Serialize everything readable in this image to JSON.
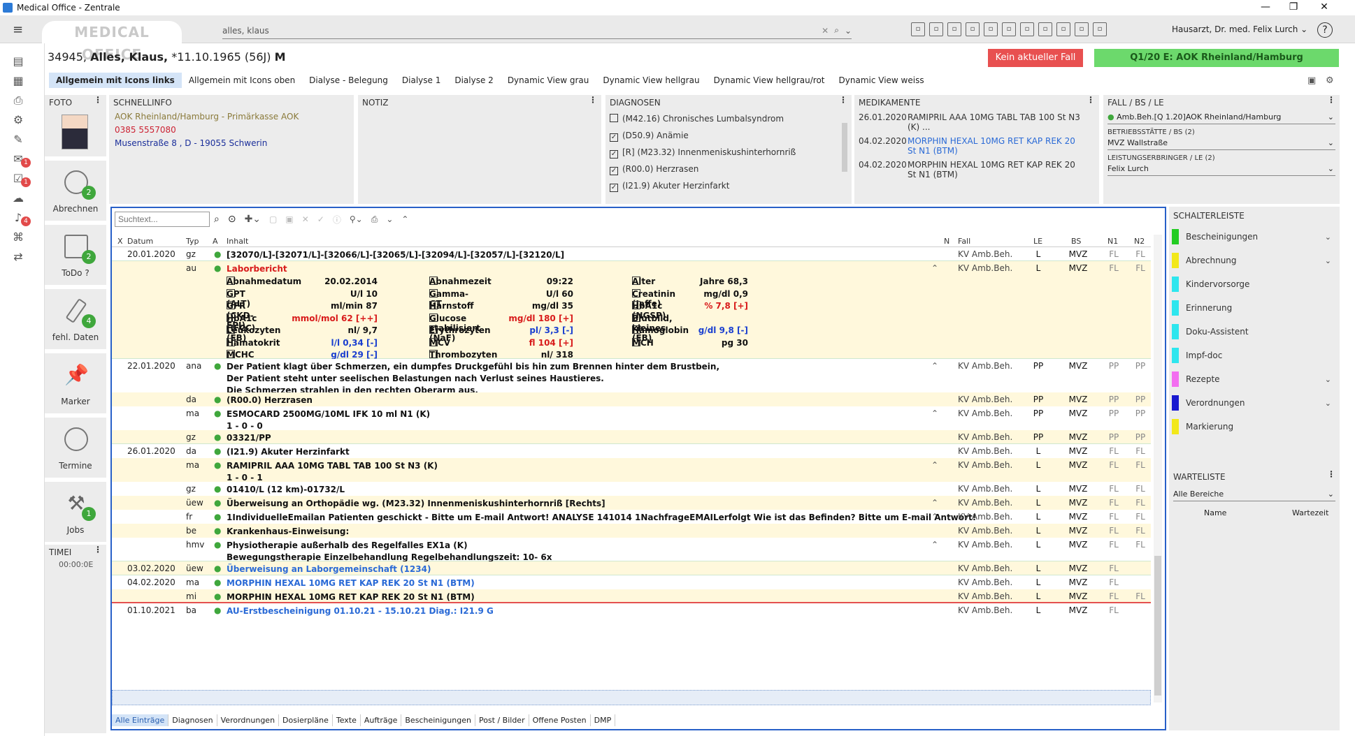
{
  "window": {
    "title": "Medical Office - Zentrale",
    "min": "—",
    "max": "❐",
    "close": "✕"
  },
  "top": {
    "logo": "MEDICAL OFFICE",
    "search_value": "alles, klaus",
    "user": "Hausarzt, Dr. med. Felix Lurch ⌄",
    "help": "?",
    "toolbar_icons": [
      "form-icon",
      "people-icon",
      "ear-icon",
      "printer-icon",
      "document-icon",
      "scan-icon",
      "pen-icon",
      "mail-icon",
      "chart-icon",
      "chat-icon",
      "tablet-icon"
    ]
  },
  "patient": {
    "id": "34945,",
    "name": "Alles, Klaus,",
    "dob": "*11.10.1965 (56J)",
    "sex": "M"
  },
  "alerts": {
    "kein_fall": "Kein aktueller Fall",
    "insurance": "Q1/20 E: AOK Rheinland/Hamburg"
  },
  "tabs": [
    "Allgemein mit Icons links",
    "Allgemein mit Icons oben",
    "Dialyse - Belegung",
    "Dialyse 1",
    "Dialyse 2",
    "Dynamic View grau",
    "Dynamic View hellgrau",
    "Dynamic View hellgrau/rot",
    "Dynamic View weiss"
  ],
  "actions": [
    {
      "label": "Abrechnen",
      "badge": "2"
    },
    {
      "label": "ToDo ?",
      "badge": "2"
    },
    {
      "label": "fehl. Daten",
      "badge": "4"
    },
    {
      "label": "Marker",
      "badge": ""
    },
    {
      "label": "Termine",
      "badge": ""
    },
    {
      "label": "Jobs",
      "badge": "1"
    }
  ],
  "timer": {
    "label": "TIMEI",
    "value": "00:00:0E"
  },
  "rail_badges": [
    "1",
    "1",
    "4"
  ],
  "foto": {
    "header": "FOTO"
  },
  "schnellinfo": {
    "header": "SCHNELLINFO",
    "kasse": "AOK Rheinland/Hamburg - Primärkasse AOK",
    "phone": "0385 5557080",
    "address": "Musenstraße 8 , D - 19055 Schwerin"
  },
  "notiz": {
    "header": "NOTIZ"
  },
  "diagnosen": {
    "header": "DIAGNOSEN",
    "items": [
      {
        "checked": false,
        "text": "(M42.16) Chronisches Lumbalsyndrom"
      },
      {
        "checked": true,
        "text": "(D50.9) Anämie"
      },
      {
        "checked": true,
        "text": "[R] (M23.32) Innenmeniskushinterhornriß"
      },
      {
        "checked": true,
        "text": "(R00.0) Herzrasen"
      },
      {
        "checked": true,
        "text": "(I21.9) Akuter Herzinfarkt"
      }
    ]
  },
  "medikamente": {
    "header": "MEDIKAMENTE",
    "items": [
      {
        "date": "26.01.2020",
        "text": "RAMIPRIL AAA 10MG TABL TAB 100 St N3 (K) ...",
        "blue": false
      },
      {
        "date": "04.02.2020",
        "text": "MORPHIN HEXAL 10MG RET KAP REK 20 St N1 (BTM)",
        "blue": true
      },
      {
        "date": "04.02.2020",
        "text": "MORPHIN HEXAL 10MG RET KAP REK 20 St N1 (BTM)",
        "blue": false
      }
    ]
  },
  "fall": {
    "header": "FALL / BS / LE",
    "fall_value": "Amb.Beh.[Q 1.20]AOK Rheinland/Hamburg",
    "bs_label": "BETRIEBSSTÄTTE / BS (2)",
    "bs_value": "MVZ Wallstraße",
    "le_label": "LEISTUNGSERBRINGER / LE (2)",
    "le_value": "Felix Lurch"
  },
  "journal": {
    "search_placeholder": "Suchtext...",
    "columns": {
      "x": "X",
      "datum": "Datum",
      "typ": "Typ",
      "a": "A",
      "inhalt": "Inhalt",
      "n": "N",
      "fall": "Fall",
      "le": "LE",
      "bs": "BS",
      "n1": "N1",
      "n2": "N2"
    },
    "rows": [
      {
        "date": "20.01.2020",
        "typ": "gz",
        "text": "[32070/L]-[32071/L]-[32066/L]-[32065/L]-[32094/L]-[32057/L]-[32120/L]",
        "fall": "KV Amb.Beh.",
        "le": "L",
        "bs": "MVZ",
        "n1": "FL",
        "n2": "FL"
      },
      {
        "date": "",
        "typ": "au",
        "text": "Laborbericht",
        "fall": "KV Amb.Beh.",
        "le": "L",
        "bs": "MVZ",
        "n1": "FL",
        "n2": "FL"
      },
      {
        "date": "22.01.2020",
        "typ": "ana",
        "text": "Der Patient klagt über Schmerzen, ein dumpfes Druckgefühl bis hin zum Brennen hinter dem Brustbein,",
        "text2": "Der Patient steht unter seelischen Belastungen nach Verlust seines Haustieres.",
        "text3": "Die Schmerzen strahlen in den rechten Oberarm aus.",
        "fall": "KV Amb.Beh.",
        "le": "PP",
        "bs": "MVZ",
        "n1": "PP",
        "n2": "PP"
      },
      {
        "date": "",
        "typ": "da",
        "text": "(R00.0) Herzrasen",
        "fall": "KV Amb.Beh.",
        "le": "PP",
        "bs": "MVZ",
        "n1": "PP",
        "n2": "PP"
      },
      {
        "date": "",
        "typ": "ma",
        "text": "ESMOCARD 2500MG/10ML IFK 10 ml N1 (K)",
        "text2": "1 - 0 - 0",
        "fall": "KV Amb.Beh.",
        "le": "PP",
        "bs": "MVZ",
        "n1": "PP",
        "n2": "PP"
      },
      {
        "date": "",
        "typ": "gz",
        "text": "03321/PP",
        "fall": "KV Amb.Beh.",
        "le": "PP",
        "bs": "MVZ",
        "n1": "PP",
        "n2": "PP"
      },
      {
        "date": "26.01.2020",
        "typ": "da",
        "text": "(I21.9) Akuter Herzinfarkt",
        "fall": "KV Amb.Beh.",
        "le": "L",
        "bs": "MVZ",
        "n1": "FL",
        "n2": "FL"
      },
      {
        "date": "",
        "typ": "ma",
        "text": "RAMIPRIL AAA 10MG TABL TAB 100 St N3 (K)",
        "text2": "1 - 0 - 1",
        "fall": "KV Amb.Beh.",
        "le": "L",
        "bs": "MVZ",
        "n1": "FL",
        "n2": "FL"
      },
      {
        "date": "",
        "typ": "gz",
        "text": "01410/L (12 km)-01732/L",
        "fall": "KV Amb.Beh.",
        "le": "L",
        "bs": "MVZ",
        "n1": "FL",
        "n2": "FL"
      },
      {
        "date": "",
        "typ": "üew",
        "text": "Überweisung an Orthopädie wg. (M23.32) Innenmeniskushinterhornriß [Rechts]",
        "fall": "KV Amb.Beh.",
        "le": "L",
        "bs": "MVZ",
        "n1": "FL",
        "n2": "FL"
      },
      {
        "date": "",
        "typ": "fr",
        "text": "1IndividuelleEmailan Patienten geschickt - Bitte um E-mail Antwort! ANALYSE 141014 1NachfrageEMAILerfolgt Wie ist das Befinden? Bitte um E-mail Antwort!",
        "fall": "KV Amb.Beh.",
        "le": "L",
        "bs": "MVZ",
        "n1": "FL",
        "n2": "FL"
      },
      {
        "date": "",
        "typ": "be",
        "text": "Krankenhaus-Einweisung:",
        "fall": "KV Amb.Beh.",
        "le": "L",
        "bs": "MVZ",
        "n1": "FL",
        "n2": "FL"
      },
      {
        "date": "",
        "typ": "hmv",
        "text": "Physiotherapie außerhalb des Regelfalles EX1a (K)",
        "text2": "Bewegungstherapie Einzelbehandlung Regelbehandlungszeit: 10- 6x",
        "fall": "KV Amb.Beh.",
        "le": "L",
        "bs": "MVZ",
        "n1": "FL",
        "n2": "FL"
      },
      {
        "date": "03.02.2020",
        "typ": "üew",
        "text": "Überweisung an Laborgemeinschaft (1234)",
        "fall": "KV Amb.Beh.",
        "le": "L",
        "bs": "MVZ",
        "n1": "FL",
        "n2": ""
      },
      {
        "date": "04.02.2020",
        "typ": "ma",
        "text": "MORPHIN HEXAL 10MG RET KAP REK 20 St N1 (BTM)",
        "fall": "KV Amb.Beh.",
        "le": "L",
        "bs": "MVZ",
        "n1": "FL",
        "n2": ""
      },
      {
        "date": "",
        "typ": "mi",
        "text": "MORPHIN HEXAL 10MG RET KAP REK 20 St N1 (BTM)",
        "fall": "KV Amb.Beh.",
        "le": "L",
        "bs": "MVZ",
        "n1": "FL",
        "n2": "FL"
      },
      {
        "date": "01.10.2021",
        "typ": "ba",
        "text": "AU-Erstbescheinigung 01.10.21 - 15.10.21 Diag.: I21.9 G",
        "fall": "KV Amb.Beh.",
        "le": "L",
        "bs": "MVZ",
        "n1": "FL",
        "n2": ""
      }
    ],
    "lab": [
      [
        {
          "n": "Abnahmedatum",
          "v": "20.02.2014",
          "c": ""
        },
        {
          "n": "Abnahmezeit",
          "v": "09:22",
          "c": ""
        },
        {
          "n": "Alter",
          "v": "68,3 Jahre",
          "c": ""
        }
      ],
      [
        {
          "n": "GPT (ALT)",
          "v": "10 U/l",
          "c": ""
        },
        {
          "n": "Gamma-GT",
          "v": "60 U/l",
          "c": ""
        },
        {
          "n": "Creatinin (Jaffe)",
          "v": "0,9 mg/dl",
          "c": ""
        }
      ],
      [
        {
          "n": "GFR (CKD-EPI)",
          "v": "87 ml/min",
          "c": ""
        },
        {
          "n": "Harnstoff",
          "v": "35 mg/dl",
          "c": ""
        },
        {
          "n": "HbA1c (NGSP)",
          "v": "[+] 7,8 %",
          "c": "red"
        }
      ],
      [
        {
          "n": "HbA1c (IFCC) (EB)",
          "v": "[++] 62 mmol/mol",
          "c": "red"
        },
        {
          "n": "Glucose stabilisiert (NaF)",
          "v": "[+] 180 mg/dl",
          "c": "red"
        },
        {
          "n": "Blutbild, kleines (EB)",
          "v": "",
          "c": ""
        }
      ],
      [
        {
          "n": "Leukozyten",
          "v": "9,7 /nl",
          "c": ""
        },
        {
          "n": "Erythrozyten",
          "v": "[-] 3,3 /pl",
          "c": "blue"
        },
        {
          "n": "Hämoglobin",
          "v": "[-] 9,8 g/dl",
          "c": "blue"
        }
      ],
      [
        {
          "n": "Hämatokrit",
          "v": "[-] 0,34 l/l",
          "c": "blue"
        },
        {
          "n": "MCV",
          "v": "[+] 104 fl",
          "c": "red"
        },
        {
          "n": "MCH",
          "v": "30 pg",
          "c": ""
        }
      ],
      [
        {
          "n": "MCHC",
          "v": "[-] 29 g/dl",
          "c": "blue"
        },
        {
          "n": "Thrombozyten",
          "v": "318 /nl",
          "c": ""
        },
        {
          "n": "",
          "v": "",
          "c": ""
        }
      ]
    ],
    "bottom_tabs": [
      "Alle Einträge",
      "Diagnosen",
      "Verordnungen",
      "Dosierpläne",
      "Texte",
      "Aufträge",
      "Bescheinigungen",
      "Post / Bilder",
      "Offene Posten",
      "DMP"
    ]
  },
  "schalterleiste": {
    "header": "SCHALTERLEISTE",
    "items": [
      {
        "label": "Bescheinigungen",
        "color": "#22cc22",
        "chev": true
      },
      {
        "label": "Abrechnung",
        "color": "#f2e81a",
        "chev": true
      },
      {
        "label": "Kindervorsorge",
        "color": "#2ee6ee",
        "chev": false
      },
      {
        "label": "Erinnerung",
        "color": "#2ee6ee",
        "chev": false
      },
      {
        "label": "Doku-Assistent",
        "color": "#2ee6ee",
        "chev": false
      },
      {
        "label": "Impf-doc",
        "color": "#2ee6ee",
        "chev": false
      },
      {
        "label": "Rezepte",
        "color": "#f36ef0",
        "chev": true
      },
      {
        "label": "Verordnungen",
        "color": "#1a1ad0",
        "chev": true
      },
      {
        "label": "Markierung",
        "color": "#f2e81a",
        "chev": false
      }
    ]
  },
  "warteliste": {
    "header": "WARTELISTE",
    "bereich": "Alle Bereiche",
    "col_name": "Name",
    "col_wartezeit": "Wartezeit"
  }
}
